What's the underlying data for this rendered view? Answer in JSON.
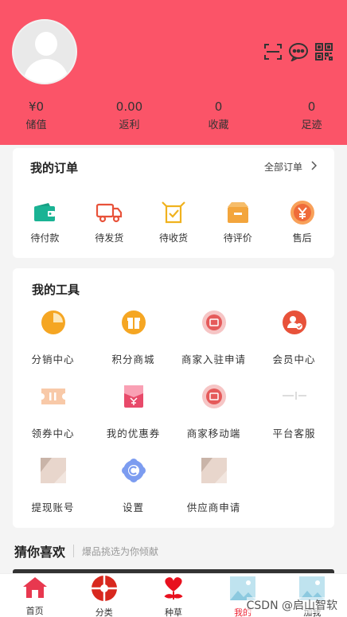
{
  "header": {
    "icons": [
      "scan-icon",
      "chat-icon",
      "qrcode-icon"
    ],
    "stats": [
      {
        "value": "¥0",
        "label": "储值"
      },
      {
        "value": "0.00",
        "label": "返利"
      },
      {
        "value": "0",
        "label": "收藏"
      },
      {
        "value": "0",
        "label": "足迹"
      }
    ]
  },
  "orders": {
    "title": "我的订单",
    "all_label": "全部订单",
    "items": [
      {
        "label": "待付款",
        "icon": "wallet-icon"
      },
      {
        "label": "待发货",
        "icon": "truck-icon"
      },
      {
        "label": "待收货",
        "icon": "receive-box-icon"
      },
      {
        "label": "待评价",
        "icon": "review-box-icon"
      },
      {
        "label": "售后",
        "icon": "after-sale-icon"
      }
    ]
  },
  "tools": {
    "title": "我的工具",
    "items": [
      {
        "label": "分销中心",
        "icon": "pie-chart-icon"
      },
      {
        "label": "积分商城",
        "icon": "gift-icon"
      },
      {
        "label": "商家入驻申请",
        "icon": "merchant-icon"
      },
      {
        "label": "会员中心",
        "icon": "member-icon"
      },
      {
        "label": "领券中心",
        "icon": "ticket-icon"
      },
      {
        "label": "我的优惠券",
        "icon": "coupon-icon"
      },
      {
        "label": "商家移动端",
        "icon": "merchant-mobile-icon"
      },
      {
        "label": "平台客服",
        "icon": "service-icon"
      },
      {
        "label": "提现账号",
        "icon": "withdraw-image-icon"
      },
      {
        "label": "设置",
        "icon": "settings-icon"
      },
      {
        "label": "供应商申请",
        "icon": "supplier-image-icon"
      }
    ]
  },
  "guess": {
    "title": "猜你喜欢",
    "subtitle": "爆品挑选为你倾献"
  },
  "tabbar": {
    "items": [
      {
        "label": "首页",
        "icon": "home-icon"
      },
      {
        "label": "分类",
        "icon": "category-icon"
      },
      {
        "label": "种草",
        "icon": "heart-icon"
      },
      {
        "label": "我的",
        "icon": "profile-icon",
        "active": true
      },
      {
        "label": "加我",
        "icon": "image-icon"
      }
    ]
  },
  "watermark": "CSDN @启山智软",
  "colors": {
    "brand": "#fb5468",
    "active_tab": "#e23"
  }
}
